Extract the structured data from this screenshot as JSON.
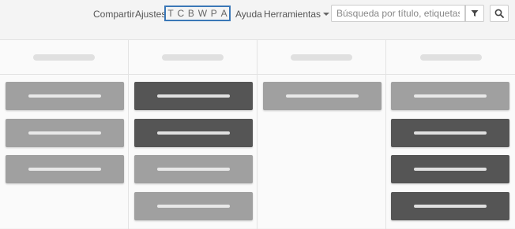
{
  "toolbar": {
    "share_label": "Compartir",
    "settings_label": "Ajustes",
    "letters": [
      "T",
      "C",
      "B",
      "W",
      "P",
      "A"
    ],
    "help_label": "Ayuda",
    "tools_label": "Herramientas"
  },
  "search": {
    "placeholder": "Búsqueda por título, etiquetas o no"
  },
  "icons": {
    "filter": "filter-icon",
    "search": "search-icon",
    "dropdown": "caret-down-icon"
  },
  "colors": {
    "accent_border": "#3a77b7",
    "card_light": "#a0a0a0",
    "card_dark": "#555555"
  },
  "board": {
    "columns": [
      {
        "cards": [
          "light",
          "light",
          "light"
        ]
      },
      {
        "cards": [
          "dark",
          "dark",
          "light",
          "light"
        ]
      },
      {
        "cards": [
          "light"
        ]
      },
      {
        "cards": [
          "light",
          "dark",
          "dark",
          "dark"
        ]
      }
    ]
  }
}
